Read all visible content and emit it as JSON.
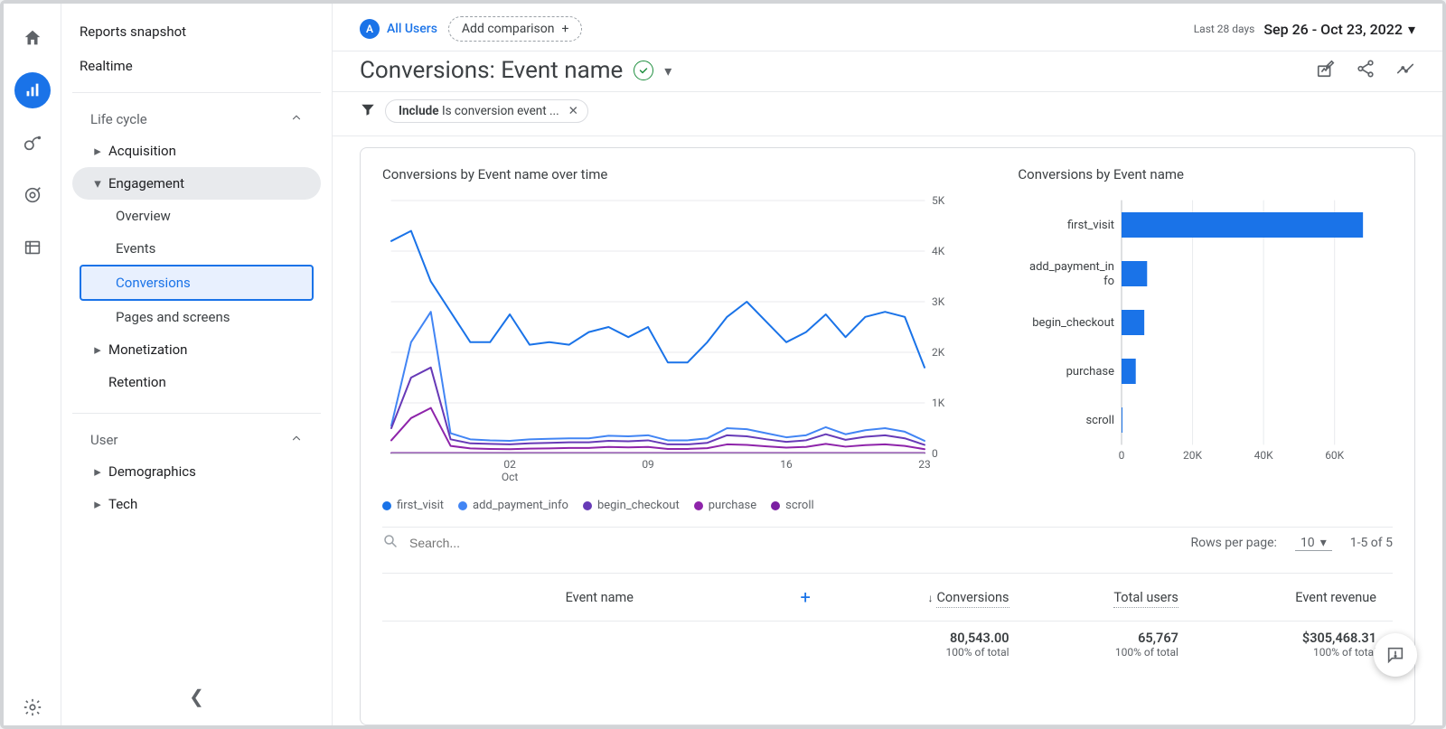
{
  "rail": {
    "active_index": 1
  },
  "sidebar": {
    "items": [
      {
        "label": "Reports snapshot"
      },
      {
        "label": "Realtime"
      }
    ],
    "groups": [
      {
        "label": "Life cycle",
        "children": [
          {
            "label": "Acquisition",
            "expanded": false
          },
          {
            "label": "Engagement",
            "expanded": true,
            "children": [
              {
                "label": "Overview"
              },
              {
                "label": "Events"
              },
              {
                "label": "Conversions",
                "selected": true
              },
              {
                "label": "Pages and screens"
              }
            ]
          },
          {
            "label": "Monetization",
            "expanded": false
          },
          {
            "label": "Retention",
            "expanded": false,
            "leaf": true
          }
        ]
      },
      {
        "label": "User",
        "children": [
          {
            "label": "Demographics",
            "expanded": false
          },
          {
            "label": "Tech",
            "expanded": false
          }
        ]
      }
    ]
  },
  "toolbar": {
    "segment_badge": "A",
    "segment_label": "All Users",
    "add_comparison": "Add comparison",
    "date_mode": "Last 28 days",
    "date_range": "Sep 26 - Oct 23, 2022"
  },
  "report": {
    "title": "Conversions: Event name",
    "filter_prefix": "Include",
    "filter_rest": "Is conversion event ..."
  },
  "charts": {
    "line_title": "Conversions by Event name over time",
    "bar_title": "Conversions by Event name"
  },
  "legend_labels": [
    "first_visit",
    "add_payment_info",
    "begin_checkout",
    "purchase",
    "scroll"
  ],
  "table_controls": {
    "search_placeholder": "Search...",
    "rows_per_page_label": "Rows per page:",
    "rows_per_page_value": "10",
    "range_label": "1-5 of 5"
  },
  "table": {
    "headers": [
      "Event name",
      "Conversions",
      "Total users",
      "Event revenue"
    ],
    "totals": {
      "conversions": "80,543.00",
      "total_users": "65,767",
      "event_revenue": "$305,468.31",
      "pct": "100% of total"
    }
  },
  "chart_data": [
    {
      "type": "line",
      "title": "Conversions by Event name over time",
      "xlabel": "Oct",
      "ylabel": "",
      "ylim": [
        0,
        5000
      ],
      "yticks": [
        0,
        1000,
        2000,
        3000,
        4000,
        5000
      ],
      "xticks": [
        "02",
        "09",
        "16",
        "23"
      ],
      "x": [
        26,
        27,
        28,
        29,
        30,
        1,
        2,
        3,
        4,
        5,
        6,
        7,
        8,
        9,
        10,
        11,
        12,
        13,
        14,
        15,
        16,
        17,
        18,
        19,
        20,
        21,
        22,
        23
      ],
      "series": [
        {
          "name": "first_visit",
          "color": "#1a73e8",
          "values": [
            4200,
            4400,
            3400,
            2800,
            2200,
            2200,
            2750,
            2150,
            2200,
            2150,
            2400,
            2500,
            2300,
            2500,
            1800,
            1800,
            2200,
            2700,
            3000,
            2600,
            2200,
            2400,
            2750,
            2300,
            2700,
            2800,
            2700,
            1700
          ]
        },
        {
          "name": "add_payment_info",
          "color": "#4285f4",
          "values": [
            550,
            2200,
            2800,
            400,
            280,
            260,
            250,
            280,
            290,
            300,
            300,
            350,
            340,
            360,
            260,
            260,
            300,
            500,
            480,
            400,
            320,
            360,
            520,
            380,
            460,
            500,
            430,
            250
          ]
        },
        {
          "name": "begin_checkout",
          "color": "#673ab7",
          "values": [
            500,
            1500,
            1700,
            280,
            200,
            190,
            180,
            200,
            210,
            220,
            220,
            250,
            240,
            260,
            180,
            180,
            210,
            360,
            340,
            280,
            230,
            260,
            380,
            270,
            330,
            360,
            300,
            170
          ]
        },
        {
          "name": "purchase",
          "color": "#8e24aa",
          "values": [
            260,
            700,
            900,
            150,
            100,
            90,
            85,
            95,
            100,
            110,
            110,
            130,
            120,
            130,
            90,
            90,
            105,
            180,
            170,
            140,
            115,
            130,
            190,
            135,
            165,
            180,
            150,
            85
          ]
        },
        {
          "name": "scroll",
          "color": "#7b1fa2",
          "values": [
            10,
            10,
            10,
            10,
            10,
            10,
            10,
            10,
            10,
            10,
            10,
            10,
            10,
            10,
            10,
            10,
            10,
            10,
            10,
            10,
            10,
            10,
            10,
            10,
            10,
            10,
            10,
            10
          ]
        }
      ]
    },
    {
      "type": "bar",
      "title": "Conversions by Event name",
      "orientation": "horizontal",
      "xlim": [
        0,
        70000
      ],
      "xticks": [
        0,
        20000,
        40000,
        60000
      ],
      "categories": [
        "first_visit",
        "add_payment_info",
        "begin_checkout",
        "purchase",
        "scroll"
      ],
      "values": [
        68000,
        7200,
        6400,
        4000,
        120
      ],
      "color": "#1a73e8"
    }
  ]
}
